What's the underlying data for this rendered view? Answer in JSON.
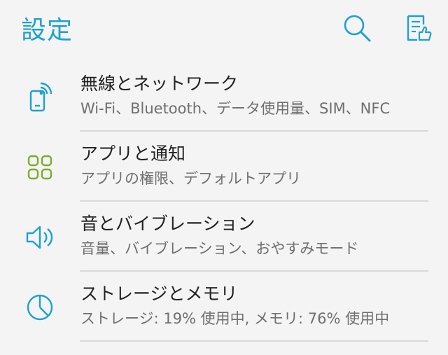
{
  "header": {
    "title": "設定",
    "title_color": "#1da1cf",
    "actions": [
      {
        "icon": "search-icon"
      },
      {
        "icon": "feedback-icon"
      }
    ]
  },
  "settings": {
    "items": [
      {
        "label": "無線とネットワーク",
        "summary": "Wi-Fi、Bluetooth、データ使用量、SIM、NFC",
        "icon": "wireless-network-icon",
        "icon_color": "#1da1cf"
      },
      {
        "label": "アプリと通知",
        "summary": "アプリの権限、デフォルトアプリ",
        "icon": "apps-grid-icon",
        "icon_color": "#7cab2d"
      },
      {
        "label": "音とバイブレーション",
        "summary": "音量、バイブレーション、おやすみモード",
        "icon": "speaker-icon",
        "icon_color": "#1da1cf"
      },
      {
        "label": "ストレージとメモリ",
        "summary": "ストレージ: 19% 使用中, メモリ: 76% 使用中",
        "icon": "storage-pie-icon",
        "icon_color": "#1da1cf"
      }
    ]
  }
}
